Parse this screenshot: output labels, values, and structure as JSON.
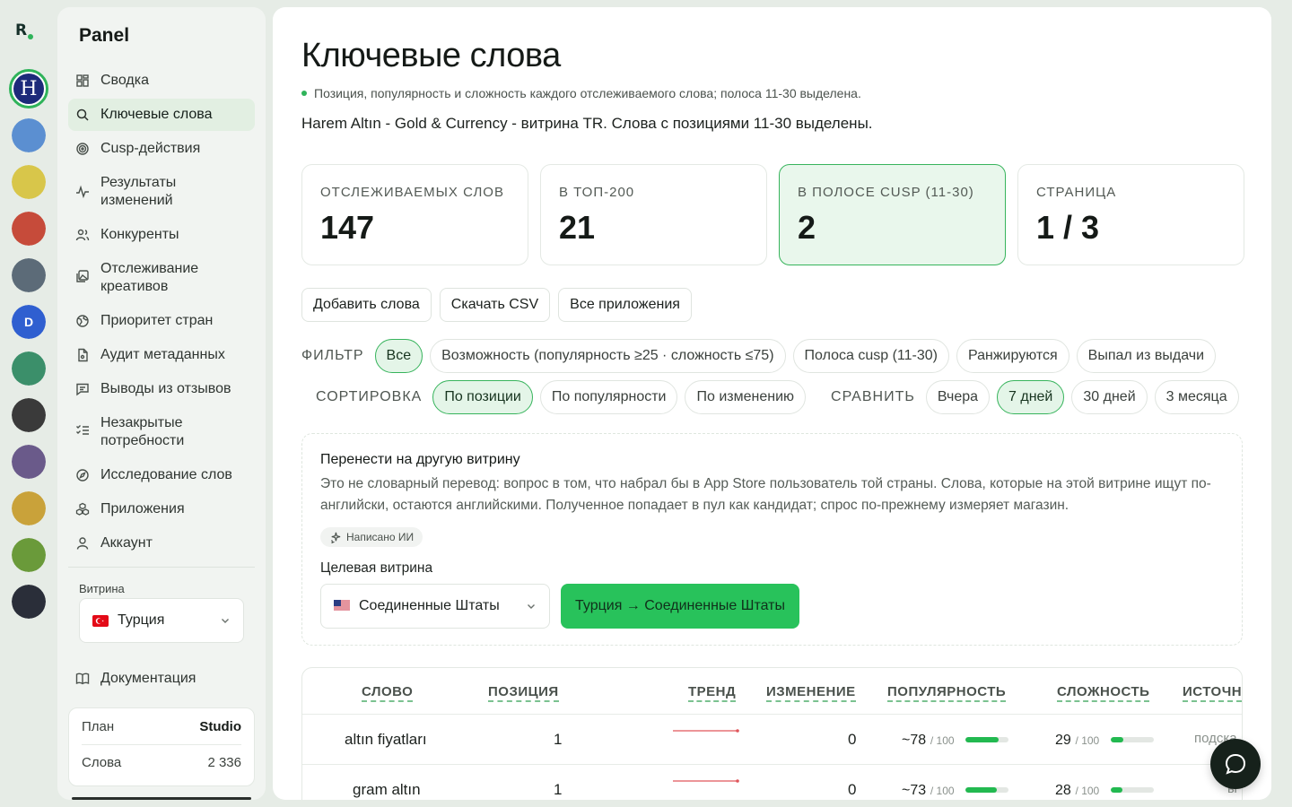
{
  "brand": {
    "logo_letter": "R",
    "accent": "#2fb35a"
  },
  "rail": {
    "apps": [
      {
        "name": "harem-altin-app-icon",
        "letter": "H",
        "color": "#1d2a7a",
        "active": true
      },
      {
        "name": "game-character-app-icon",
        "color": "#5b8fd1"
      },
      {
        "name": "altin-app-icon",
        "color": "#d8c64a"
      },
      {
        "name": "blocks-app-icon",
        "color": "#c64b3a"
      },
      {
        "name": "chart-app-icon",
        "color": "#5c6b78"
      },
      {
        "name": "d-app-icon",
        "letter": "D",
        "color": "#2f5fd0"
      },
      {
        "name": "money-app-icon",
        "color": "#3b8f6a"
      },
      {
        "name": "investing-app-icon",
        "color": "#3a3a3a"
      },
      {
        "name": "hero-app-icon",
        "color": "#6a5a8a"
      },
      {
        "name": "temple-app-icon",
        "color": "#c9a23a"
      },
      {
        "name": "temple-green-app-icon",
        "color": "#6a9a3a"
      },
      {
        "name": "tradingview-app-icon",
        "color": "#2a2e39"
      }
    ]
  },
  "sidebar": {
    "title": "Panel",
    "items": [
      {
        "label": "Сводка",
        "icon": "dashboard-icon"
      },
      {
        "label": "Ключевые слова",
        "icon": "search-icon",
        "active": true
      },
      {
        "label": "Cusp-действия",
        "icon": "target-icon"
      },
      {
        "label": "Результаты изменений",
        "icon": "activity-icon"
      },
      {
        "label": "Конкуренты",
        "icon": "users-icon"
      },
      {
        "label": "Отслеживание креативов",
        "icon": "images-icon"
      },
      {
        "label": "Приоритет стран",
        "icon": "globe-icon"
      },
      {
        "label": "Аудит метаданных",
        "icon": "file-icon"
      },
      {
        "label": "Выводы из отзывов",
        "icon": "message-icon"
      },
      {
        "label": "Незакрытые потребности",
        "icon": "list-check-icon"
      },
      {
        "label": "Исследование слов",
        "icon": "compass-icon"
      },
      {
        "label": "Приложения",
        "icon": "boxes-icon"
      },
      {
        "label": "Аккаунт",
        "icon": "user-icon"
      }
    ],
    "store_label": "Витрина",
    "store_value": "Турция",
    "docs_label": "Документация",
    "plan": {
      "plan_label": "План",
      "plan_value": "Studio",
      "words_label": "Слова",
      "words_value": "2 336"
    }
  },
  "main": {
    "title": "Ключевые слова",
    "note": "Позиция, популярность и сложность каждого отслеживаемого слова; полоса 11-30 выделена.",
    "description": "Harem Altın - Gold & Currency - витрина TR. Слова с позициями 11-30 выделены.",
    "stats": [
      {
        "label": "ОТСЛЕЖИВАЕМЫХ СЛОВ",
        "value": "147"
      },
      {
        "label": "В ТОП-200",
        "value": "21"
      },
      {
        "label": "В ПОЛОСЕ CUSP (11-30)",
        "value": "2",
        "highlight": true
      },
      {
        "label": "СТРАНИЦА",
        "value": "1 / 3"
      }
    ],
    "buttons": [
      "Добавить слова",
      "Скачать CSV",
      "Все приложения"
    ],
    "filter": {
      "label": "ФИЛЬТР",
      "options": [
        "Все",
        "Возможность (популярность ≥25 · сложность ≤75)",
        "Полоса cusp (11-30)",
        "Ранжируются",
        "Выпал из выдачи"
      ],
      "selected": 0
    },
    "sort": {
      "label": "СОРТИРОВКА",
      "options": [
        "По позиции",
        "По популярности",
        "По изменению"
      ],
      "selected": 0
    },
    "compare": {
      "label": "СРАВНИТЬ",
      "options": [
        "Вчера",
        "7 дней",
        "30 дней",
        "3 месяца"
      ],
      "selected": 1
    },
    "transfer": {
      "title": "Перенести на другую витрину",
      "text": "Это не словарный перевод: вопрос в том, что набрал бы в App Store пользователь той страны. Слова, которые на этой витрине ищут по-английски, остаются английскими. Полученное попадает в пул как кандидат; спрос по-прежнему измеряет магазин.",
      "ai_badge": "Написано ИИ",
      "target_label": "Целевая витрина",
      "target_value": "Соединенные Штаты",
      "action_label": "Турция → Соединенные Штаты"
    },
    "table": {
      "headers": {
        "word": "СЛОВО",
        "position": "ПОЗИЦИЯ",
        "trend": "ТРЕНД",
        "change": "ИЗМЕНЕНИЕ",
        "popularity": "ПОПУЛЯРНОСТЬ",
        "difficulty": "СЛОЖНОСТЬ",
        "source": "ИСТОЧН"
      },
      "rows": [
        {
          "word": "altın fiyatları",
          "position": "1",
          "change": "0",
          "popularity": "~78",
          "pop_of": "/ 100",
          "pop_level": 78,
          "difficulty": "29",
          "diff_of": "/ 100",
          "diff_level": 29,
          "source": "подска"
        },
        {
          "word": "gram altın",
          "position": "1",
          "change": "0",
          "popularity": "~73",
          "pop_of": "/ 100",
          "pop_level": 73,
          "difficulty": "28",
          "diff_of": "/ 100",
          "diff_level": 28,
          "source": "ы"
        }
      ]
    }
  }
}
